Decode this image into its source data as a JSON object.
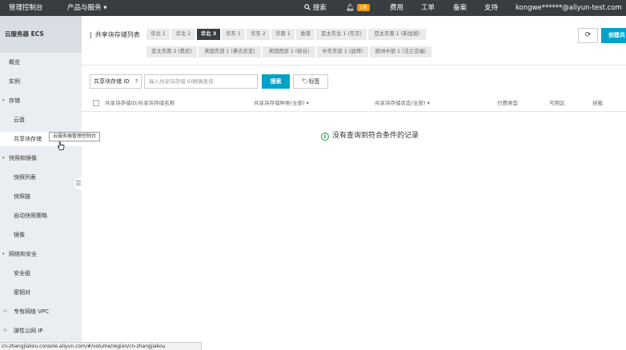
{
  "topbar": {
    "console": "管理控制台",
    "products": "产品与服务 ▾",
    "search": "搜索",
    "badge": "1抢",
    "billing": "费用",
    "ticket": "工单",
    "record": "备案",
    "support": "支持",
    "user": "kongwe******@aliyun-test.com"
  },
  "sidebar": {
    "header": "云服务器 ECS",
    "items": {
      "overview": "概览",
      "instances": "实例",
      "storage": "存储",
      "disks": "云盘",
      "shared_storage": "共享块存储",
      "snapshots_images": "快照和镜像",
      "snapshot_list": "快照列表",
      "snapshot_chain": "快照链",
      "auto_snapshot": "自动快照策略",
      "images": "镜像",
      "network_security": "网络和安全",
      "security_groups": "安全组",
      "key_pairs": "密钥对",
      "vpc": "专有网络 VPC",
      "eip": "弹性公网 IP"
    },
    "tooltip": "云服务器管理控制台"
  },
  "main": {
    "title": "共享块存储列表",
    "regions_row1": [
      "华北 1",
      "华北 2",
      "华北 3",
      "华东 1",
      "华东 2",
      "华南 1",
      "香港",
      "亚太东北 1 (东京)",
      "亚太东南 1 (新加坡)"
    ],
    "regions_row2": [
      "亚太东南 2 (悉尼)",
      "美国东部 1 (弗吉尼亚)",
      "美国西部 1 (硅谷)",
      "中东东部 1 (迪拜)",
      "欧洲中部 1 (法兰克福)"
    ],
    "active_region": "华北 3",
    "create_label": "创建共",
    "filter_select": "共享块存储 ID",
    "search_placeholder": "输入共享块存储 ID精确查询",
    "search_button": "搜索",
    "tag_button": "标签",
    "columns": [
      "共享块存储ID/共享块存储名称",
      "共享块存储种类(全部) ▾",
      "共享块存储状态(全部) ▾",
      "付费类型",
      "可用区",
      "挂载"
    ],
    "empty_message": "没有查询到符合条件的记录"
  },
  "statusbar": "cn-zhangjiakou.console.aliyun.com/#/volume/region/cn-zhangjiakou"
}
